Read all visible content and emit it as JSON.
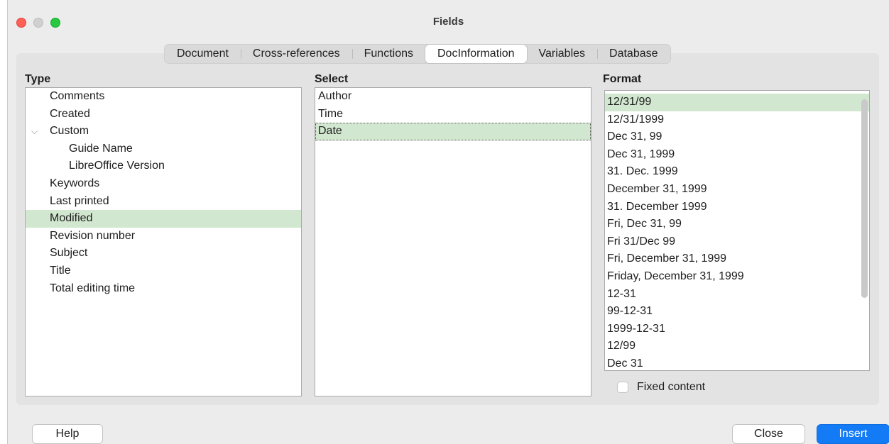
{
  "window": {
    "title": "Fields"
  },
  "tabs": [
    {
      "label": "Document"
    },
    {
      "label": "Cross-references"
    },
    {
      "label": "Functions"
    },
    {
      "label": "DocInformation",
      "active": true
    },
    {
      "label": "Variables"
    },
    {
      "label": "Database"
    }
  ],
  "type": {
    "label": "Type",
    "items": [
      {
        "label": "Comments"
      },
      {
        "label": "Created"
      },
      {
        "label": "Custom",
        "expanded": true
      },
      {
        "label": "Guide Name",
        "child": true
      },
      {
        "label": "LibreOffice Version",
        "child": true
      },
      {
        "label": "Keywords"
      },
      {
        "label": "Last printed"
      },
      {
        "label": "Modified",
        "selected": true
      },
      {
        "label": "Revision number"
      },
      {
        "label": "Subject"
      },
      {
        "label": "Title"
      },
      {
        "label": "Total editing time"
      }
    ]
  },
  "select": {
    "label": "Select",
    "items": [
      {
        "label": "Author"
      },
      {
        "label": "Time"
      },
      {
        "label": "Date",
        "selected": true
      }
    ]
  },
  "format": {
    "label": "Format",
    "items": [
      {
        "label": "12/31/99",
        "selected": true
      },
      {
        "label": "12/31/1999"
      },
      {
        "label": "Dec 31, 99"
      },
      {
        "label": "Dec 31, 1999"
      },
      {
        "label": "31. Dec. 1999"
      },
      {
        "label": "December 31, 1999"
      },
      {
        "label": "31. December 1999"
      },
      {
        "label": "Fri, Dec 31, 99"
      },
      {
        "label": "Fri 31/Dec 99"
      },
      {
        "label": "Fri, December 31, 1999"
      },
      {
        "label": "Friday, December 31, 1999"
      },
      {
        "label": "12-31"
      },
      {
        "label": "99-12-31"
      },
      {
        "label": "1999-12-31"
      },
      {
        "label": "12/99"
      },
      {
        "label": "Dec 31"
      }
    ]
  },
  "fixed_content": {
    "label": "Fixed content",
    "checked": false
  },
  "buttons": {
    "help": "Help",
    "close": "Close",
    "insert": "Insert"
  },
  "colors": {
    "selection": "#d2e7cf",
    "accent": "#147bf7"
  }
}
